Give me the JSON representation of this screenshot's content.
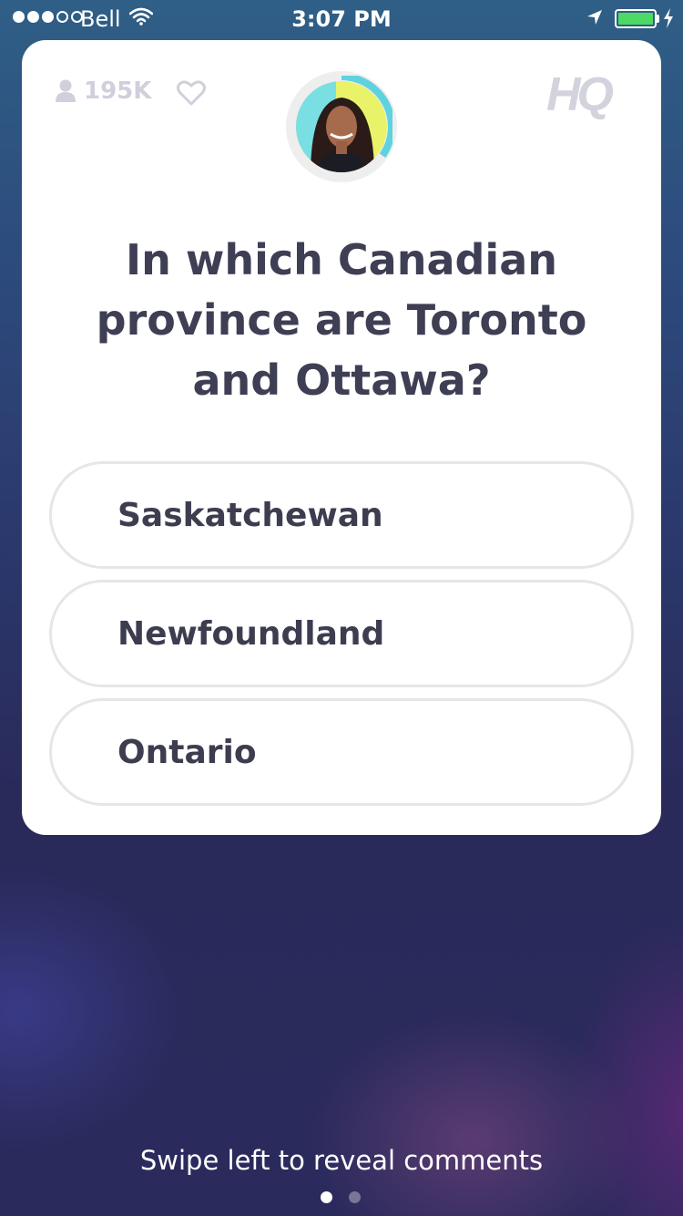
{
  "status_bar": {
    "signal_filled": 3,
    "signal_total": 5,
    "carrier": "Bell",
    "time": "3:07 PM",
    "battery_level": 1.0,
    "battery_color": "#4cd964"
  },
  "header": {
    "viewer_count": "195K",
    "logo": "HQ"
  },
  "question": {
    "text": "In which Canadian province are Toronto and Ottawa?"
  },
  "answers": [
    {
      "label": "Saskatchewan"
    },
    {
      "label": "Newfoundland"
    },
    {
      "label": "Ontario"
    }
  ],
  "footer": {
    "hint": "Swipe left to reveal comments",
    "page_count": 2,
    "active_page": 1
  },
  "colors": {
    "accent_ring": "#5fd2e0",
    "text_dark": "#3e3e54",
    "muted": "#cfd0db"
  }
}
